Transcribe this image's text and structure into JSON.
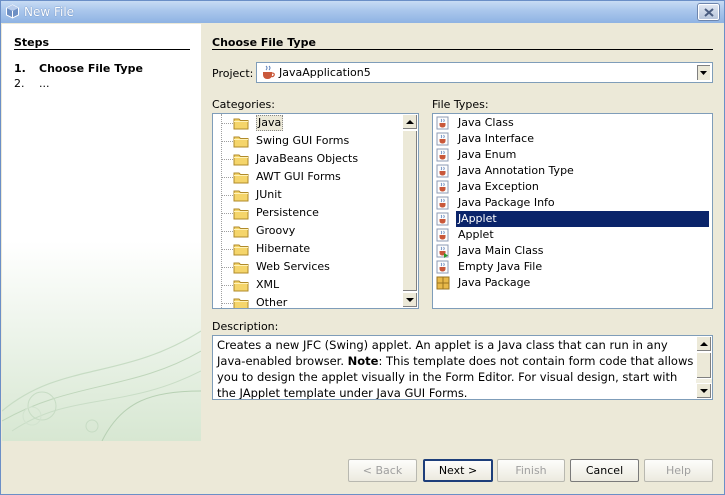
{
  "window": {
    "title": "New File"
  },
  "steps": {
    "heading": "Steps",
    "items": [
      {
        "num": "1.",
        "label": "Choose File Type"
      },
      {
        "num": "2.",
        "label": "..."
      }
    ]
  },
  "main": {
    "title": "Choose File Type",
    "project_label": "Project:",
    "project_value": "JavaApplication5",
    "categories_label": "Categories:",
    "file_types_label": "File Types:",
    "description_label": "Description:",
    "description": {
      "part1": "Creates a new JFC (Swing) applet. An applet is a Java class that can run in any Java-enabled browser. ",
      "note": "Note",
      "part2": ": This template does not contain form code that allows you to design the applet visually in the Form Editor. For visual design, start with the JApplet template under Java GUI Forms."
    }
  },
  "categories": [
    "Java",
    "Swing GUI Forms",
    "JavaBeans Objects",
    "AWT GUI Forms",
    "JUnit",
    "Persistence",
    "Groovy",
    "Hibernate",
    "Web Services",
    "XML",
    "Other"
  ],
  "file_types": [
    "Java Class",
    "Java Interface",
    "Java Enum",
    "Java Annotation Type",
    "Java Exception",
    "Java Package Info",
    "JApplet",
    "Applet",
    "Java Main Class",
    "Empty Java File",
    "Java Package"
  ],
  "selected_category": "Java",
  "selected_file_type": "JApplet",
  "buttons": {
    "back": "< Back",
    "next": "Next >",
    "finish": "Finish",
    "cancel": "Cancel",
    "help": "Help"
  },
  "colors": {
    "selection": "#0a246a",
    "folder": "#f5d56b"
  }
}
